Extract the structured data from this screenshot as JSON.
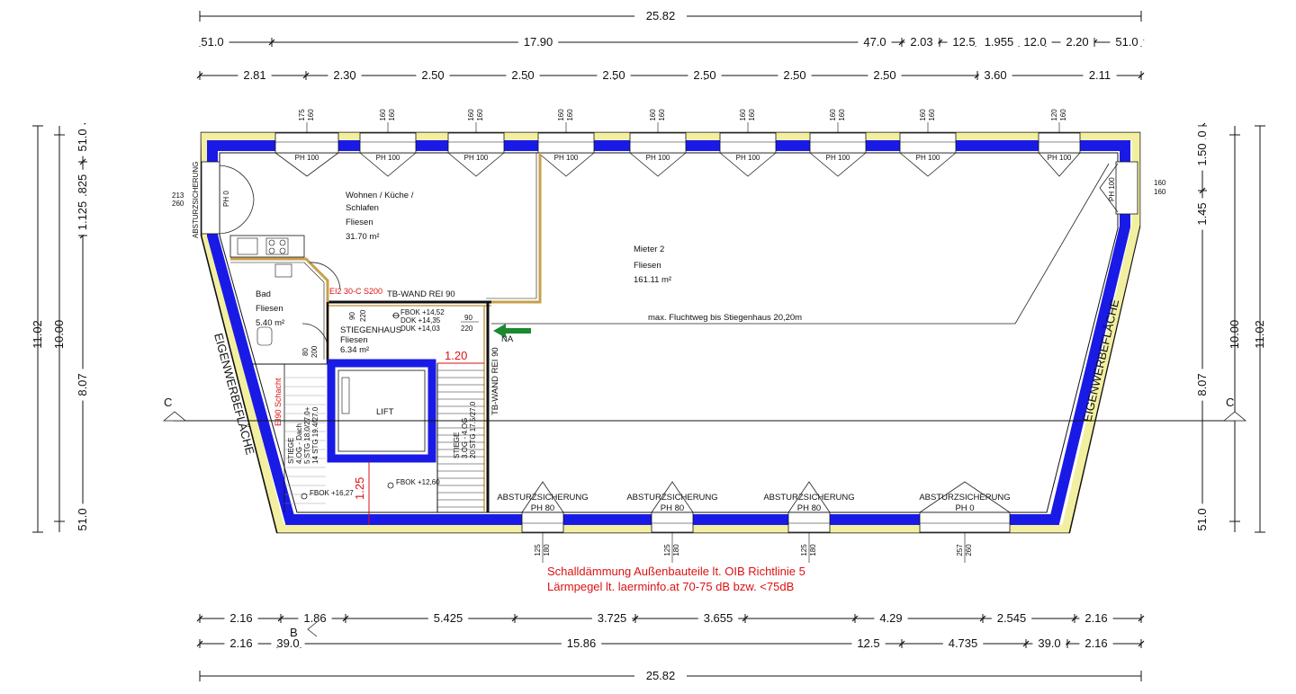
{
  "dimensions": {
    "top_total": "25.82",
    "top_row2": [
      "51.0",
      "17.90",
      "47.0",
      "2.03",
      "12.5",
      "1.955",
      "12.0",
      "2.20",
      "51.0"
    ],
    "top_row3": [
      "2.81",
      "2.30",
      "2.50",
      "2.50",
      "2.50",
      "2.50",
      "2.50",
      "2.50",
      "3.60",
      "2.11"
    ],
    "left_outer": "11.02",
    "left_inner": [
      "51.0",
      "1.825",
      "1.125",
      "8.07",
      "51.0"
    ],
    "right_outer": "11.02",
    "right_mid": "10.00",
    "left_mid": "10.00",
    "right_inner": [
      "51.0",
      "1.50",
      "1.45",
      "8.07",
      "51.0"
    ],
    "bottom_row1": [
      "2.16",
      "1.86",
      "5.425",
      "3.725",
      "3.655",
      "4.29",
      "2.545",
      "2.16"
    ],
    "bottom_row2": [
      "2.16",
      "39.0",
      "15.86",
      "12.5",
      "4.735",
      "39.0",
      "2.16"
    ],
    "bottom_total": "25.82"
  },
  "windows": {
    "top_labels": [
      "PH 100",
      "PH 100",
      "PH 100",
      "PH 100",
      "PH 100",
      "PH 100",
      "PH 100",
      "PH 100",
      "PH 100"
    ],
    "top_dims": [
      "175\n160",
      "160\n160",
      "160\n160",
      "160\n160",
      "160\n160",
      "160\n160",
      "160\n160",
      "160\n160",
      "120\n160"
    ],
    "right_window_label": "PH 100",
    "right_window_dims": [
      "160",
      "160"
    ],
    "left_window_label": "PH 0",
    "left_window_dims": [
      "213",
      "260"
    ],
    "bottom_labels": [
      "PH 80",
      "PH 80",
      "PH 80",
      "PH 0"
    ],
    "bottom_captions": [
      "ABSTURZSICHERUNG",
      "ABSTURZSICHERUNG",
      "ABSTURZSICHERUNG",
      "ABSTURZSICHERUNG"
    ],
    "bottom_dims": [
      "125\n180",
      "125\n180",
      "125\n180",
      "257\n260"
    ]
  },
  "rooms": {
    "living": {
      "name1": "Wohnen / Küche /",
      "name2": "Schlafen",
      "floor": "Fliesen",
      "area": "31.70 m²"
    },
    "tenant": {
      "name": "Mieter 2",
      "floor": "Fliesen",
      "area": "161.11 m²"
    },
    "bath": {
      "name": "Bad",
      "floor": "Fliesen",
      "area": "5.40 m²"
    },
    "stair": {
      "name": "STIEGENHAUS",
      "floor": "Fliesen",
      "area": "6.34 m²"
    },
    "lift": {
      "name": "LIFT"
    }
  },
  "annotations": {
    "absturz_left": "ABSTURZSICHERUNG",
    "tb_wand_top": "TB-WAND  REI 90",
    "tb_wand_vertical": "TB-WAND  REI 90",
    "ei2": "EI2 30-C S200",
    "fbok_1": "FBOK +14,52",
    "dok": "DOK +14,35",
    "duk": "DUK +14,03",
    "door_90": "90",
    "door_220": "220",
    "bath_door_90": "90",
    "bath_door_220": "220",
    "stair_door_80": "80",
    "stair_door_200": "200",
    "na": "NA",
    "escape": "max. Fluchtweg bis Stiegenhaus 20,20m",
    "eigen_left": "EIGENWERBEFLÄCHE",
    "eigen_right": "EIGENWERBEFLÄCHE",
    "dim_120": "1.20",
    "dim_125": "1.25",
    "ei90_schacht": "EI90 Schacht",
    "stair_left_text": [
      "STIEGE",
      "4.OG - Dach",
      "5 STG 18.0/27.0+",
      "14 STG 19.4/27.0"
    ],
    "stair_right_text": [
      "STIEGE",
      "3.OG - 4.OG",
      "20 STG 17.5/27.0"
    ],
    "fbok_2": "FBOK +12,60",
    "fbok_3": "FBOK +16,27",
    "section_c_left": "C",
    "section_c_right": "C",
    "section_b": "B",
    "note_line1": "Schalldämmung Außenbauteile lt. OIB Richtlinie 5",
    "note_line2": "Lärmpegel lt. laerminfo.at 70-75 dB bzw. <75dB"
  },
  "colors": {
    "wall_blue": "#1a1ae6",
    "insulation_yellow": "#f2f0a0",
    "annotation_red": "#dd1111",
    "arrow_green": "#1a8a2e",
    "wall_outline": "#111111"
  }
}
